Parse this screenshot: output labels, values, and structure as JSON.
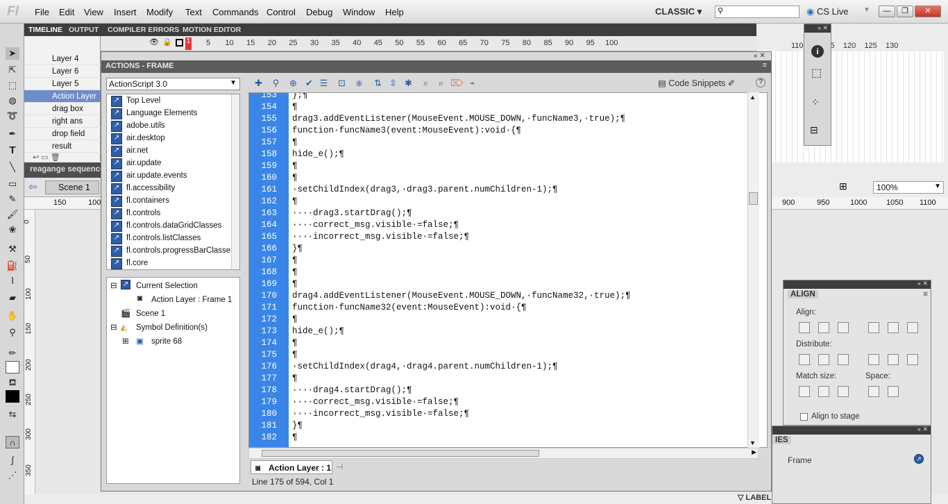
{
  "app": {
    "logo": "Fl",
    "workspace": "CLASSIC",
    "cs_live": "CS Live"
  },
  "menu": [
    "File",
    "Edit",
    "View",
    "Insert",
    "Modify",
    "Text",
    "Commands",
    "Control",
    "Debug",
    "Window",
    "Help"
  ],
  "panel_tabs": [
    "TIMELINE",
    "OUTPUT",
    "COMPILER ERRORS",
    "MOTION EDITOR"
  ],
  "layers": [
    "Layer 4",
    "Layer 6",
    "Layer 5",
    "Action Layer",
    "drag box",
    "right ans",
    "drop field",
    "result"
  ],
  "timeline_ruler": [
    "5",
    "10",
    "15",
    "20",
    "25",
    "30",
    "35",
    "40",
    "45",
    "50",
    "55",
    "60",
    "65",
    "70",
    "75",
    "80",
    "85",
    "90",
    "95",
    "100",
    "110",
    "115",
    "120",
    "125",
    "130"
  ],
  "timeline_frame": "1",
  "scene": {
    "breadcrumb": "reagange sequence",
    "name": "Scene 1",
    "zoom": "100%"
  },
  "ruler_h_left": [
    "150",
    "100"
  ],
  "ruler_h_right": [
    "900",
    "950",
    "1000",
    "1050",
    "1100"
  ],
  "ruler_v": [
    "0",
    "50",
    "100",
    "150",
    "200",
    "250",
    "300",
    "350"
  ],
  "actions": {
    "title": "ACTIONS - FRAME",
    "language": "ActionScript 3.0",
    "packages": [
      "Top Level",
      "Language Elements",
      "adobe.utils",
      "air.desktop",
      "air.net",
      "air.update",
      "air.update.events",
      "fl.accessibility",
      "fl.containers",
      "fl.controls",
      "fl.controls.dataGridClasses",
      "fl.controls.listClasses",
      "fl.controls.progressBarClasses",
      "fl.core"
    ],
    "tree": {
      "current_selection": "Current Selection",
      "frame": "Action Layer : Frame 1",
      "scene": "Scene 1",
      "symbols": "Symbol Definition(s)",
      "sprite": "sprite 68"
    },
    "code_snippets": "Code Snippets",
    "lines": [
      {
        "n": "153",
        "t": "};¶"
      },
      {
        "n": "154",
        "t": "¶"
      },
      {
        "n": "155",
        "t": "drag3.addEventListener(MouseEvent.MOUSE_DOWN,·funcName3,·true);¶"
      },
      {
        "n": "156",
        "t": "function·funcName3(event:MouseEvent):void·{¶"
      },
      {
        "n": "157",
        "t": "¶"
      },
      {
        "n": "158",
        "t": "hide_e();¶"
      },
      {
        "n": "159",
        "t": "¶"
      },
      {
        "n": "160",
        "t": "¶"
      },
      {
        "n": "161",
        "t": "·setChildIndex(drag3,·drag3.parent.numChildren-1);¶"
      },
      {
        "n": "162",
        "t": "¶"
      },
      {
        "n": "163",
        "t": "····drag3.startDrag();¶"
      },
      {
        "n": "164",
        "t": "····correct_msg.visible·=false;¶"
      },
      {
        "n": "165",
        "t": "····incorrect_msg.visible·=false;¶"
      },
      {
        "n": "166",
        "t": "}¶"
      },
      {
        "n": "167",
        "t": "¶"
      },
      {
        "n": "168",
        "t": "¶"
      },
      {
        "n": "169",
        "t": "¶"
      },
      {
        "n": "170",
        "t": "drag4.addEventListener(MouseEvent.MOUSE_DOWN,·funcName32,·true);¶"
      },
      {
        "n": "171",
        "t": "function·funcName32(event:MouseEvent):void·{¶"
      },
      {
        "n": "172",
        "t": "¶"
      },
      {
        "n": "173",
        "t": "hide_e();¶"
      },
      {
        "n": "174",
        "t": "¶"
      },
      {
        "n": "175",
        "t": "¶"
      },
      {
        "n": "176",
        "t": "·setChildIndex(drag4,·drag4.parent.numChildren-1);¶"
      },
      {
        "n": "177",
        "t": "¶"
      },
      {
        "n": "178",
        "t": "····drag4.startDrag();¶"
      },
      {
        "n": "179",
        "t": "····correct_msg.visible·=false;¶"
      },
      {
        "n": "180",
        "t": "····incorrect_msg.visible·=false;¶"
      },
      {
        "n": "181",
        "t": "}¶"
      },
      {
        "n": "182",
        "t": "¶"
      }
    ],
    "layer_tab": "Action Layer : 1",
    "status": "Line 175 of 594, Col 1"
  },
  "align": {
    "title": "ALIGN",
    "align": "Align:",
    "distribute": "Distribute:",
    "match_size": "Match size:",
    "space": "Space:",
    "to_stage": "Align to stage"
  },
  "properties": {
    "tab": "IES",
    "frame": "Frame",
    "label": "LABEL"
  }
}
